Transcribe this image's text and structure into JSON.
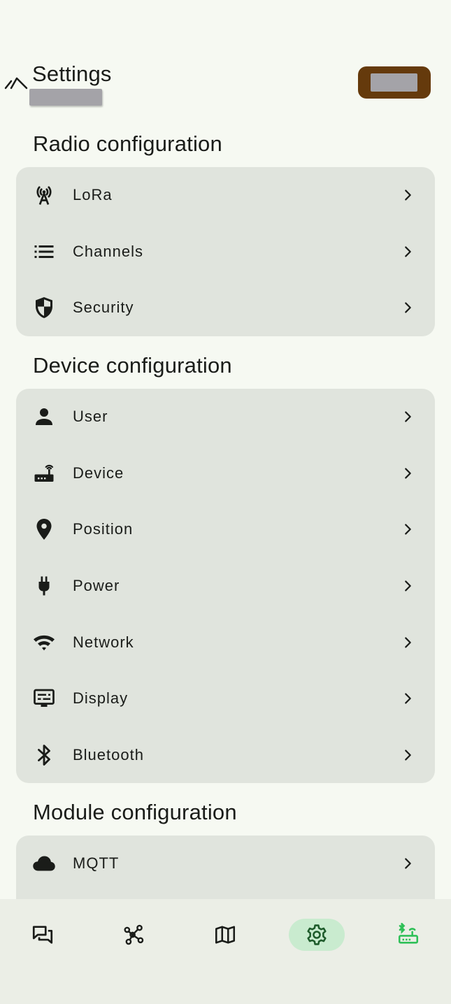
{
  "header": {
    "title": "Settings"
  },
  "sections": [
    {
      "title": "Radio configuration",
      "items": [
        {
          "label": "LoRa",
          "icon": "lora-antenna-icon"
        },
        {
          "label": "Channels",
          "icon": "list-icon"
        },
        {
          "label": "Security",
          "icon": "shield-icon"
        }
      ]
    },
    {
      "title": "Device configuration",
      "items": [
        {
          "label": "User",
          "icon": "person-icon"
        },
        {
          "label": "Device",
          "icon": "router-icon"
        },
        {
          "label": "Position",
          "icon": "location-pin-icon"
        },
        {
          "label": "Power",
          "icon": "power-plug-icon"
        },
        {
          "label": "Network",
          "icon": "wifi-icon"
        },
        {
          "label": "Display",
          "icon": "display-icon"
        },
        {
          "label": "Bluetooth",
          "icon": "bluetooth-icon"
        }
      ]
    },
    {
      "title": "Module configuration",
      "items": [
        {
          "label": "MQTT",
          "icon": "cloud-icon"
        }
      ]
    }
  ],
  "bottom_nav": [
    {
      "icon": "messages-icon",
      "active": false
    },
    {
      "icon": "nodes-graph-icon",
      "active": false
    },
    {
      "icon": "map-icon",
      "active": false
    },
    {
      "icon": "settings-gear-icon",
      "active": true
    },
    {
      "icon": "connected-router-icon",
      "active": false
    }
  ],
  "colors": {
    "background": "#f6f9f2",
    "card": "#e0e4dd",
    "chip": "#653a0c",
    "active_nav": "#c9ebcf",
    "accent_green": "#2fc058"
  }
}
